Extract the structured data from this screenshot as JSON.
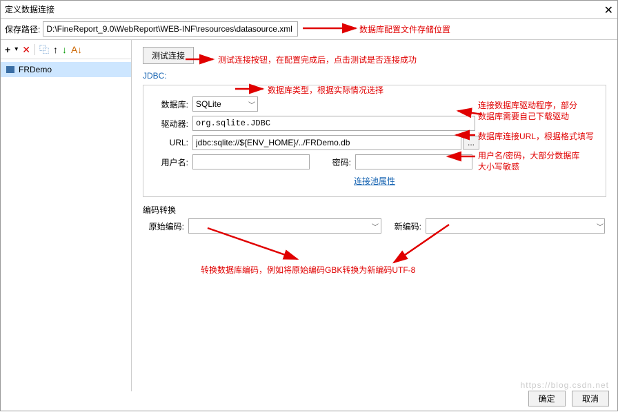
{
  "window": {
    "title": "定义数据连接"
  },
  "path": {
    "label": "保存路径:",
    "value": "D:\\FineReport_9.0\\WebReport\\WEB-INF\\resources\\datasource.xml"
  },
  "sidebar": {
    "items": [
      {
        "label": "FRDemo"
      }
    ]
  },
  "toolbar_icons": {
    "add": "+",
    "dropdown": "▾",
    "delete": "✕",
    "copy": "⿻",
    "up": "↑",
    "down": "↓",
    "sort": "A↓"
  },
  "main": {
    "test_btn": "测试连接",
    "jdbc_title": "JDBC:",
    "db_label": "数据库:",
    "db_value": "SQLite",
    "driver_label": "驱动器:",
    "driver_value": "org.sqlite.JDBC",
    "url_label": "URL:",
    "url_value": "jdbc:sqlite://${ENV_HOME}/../FRDemo.db",
    "user_label": "用户名:",
    "user_value": "",
    "pwd_label": "密码:",
    "pwd_value": "",
    "pool_link": "连接池属性",
    "encode_title": "编码转换",
    "orig_label": "原始编码:",
    "orig_value": "",
    "new_label": "新编码:",
    "new_value": ""
  },
  "annotations": {
    "path": "数据库配置文件存储位置",
    "test": "测试连接按钮，在配置完成后，点击测试是否连接成功",
    "dbtype": "数据库类型，根据实际情况选择",
    "driver1": "连接数据库驱动程序，部分",
    "driver2": "数据库需要自己下载驱动",
    "url": "数据库连接URL，根据格式填写",
    "user1": "用户名/密码，大部分数据库",
    "user2": "大小写敏感",
    "encode": "转换数据库编码，例如将原始编码GBK转换为新编码UTF-8"
  },
  "footer": {
    "ok": "确定",
    "cancel": "取消"
  },
  "watermark": "https://blog.csdn.net"
}
